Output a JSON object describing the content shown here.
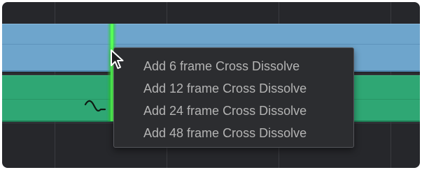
{
  "context_menu": {
    "items": [
      {
        "label": "Add 6 frame Cross Dissolve"
      },
      {
        "label": "Add 12 frame Cross Dissolve"
      },
      {
        "label": "Add 24 frame Cross Dissolve"
      },
      {
        "label": "Add 48 frame Cross Dissolve"
      }
    ]
  },
  "colors": {
    "timeline_background": "#26272b",
    "video_clip": "#6ea5cc",
    "audio_clip": "#2fa774",
    "edit_point_highlight": "#57ff57",
    "menu_background": "#2c2d30",
    "menu_text": "#b4b4b4"
  },
  "icons": {
    "fade_handle": "audio-fade-curve-icon",
    "cursor": "mouse-pointer-icon"
  }
}
